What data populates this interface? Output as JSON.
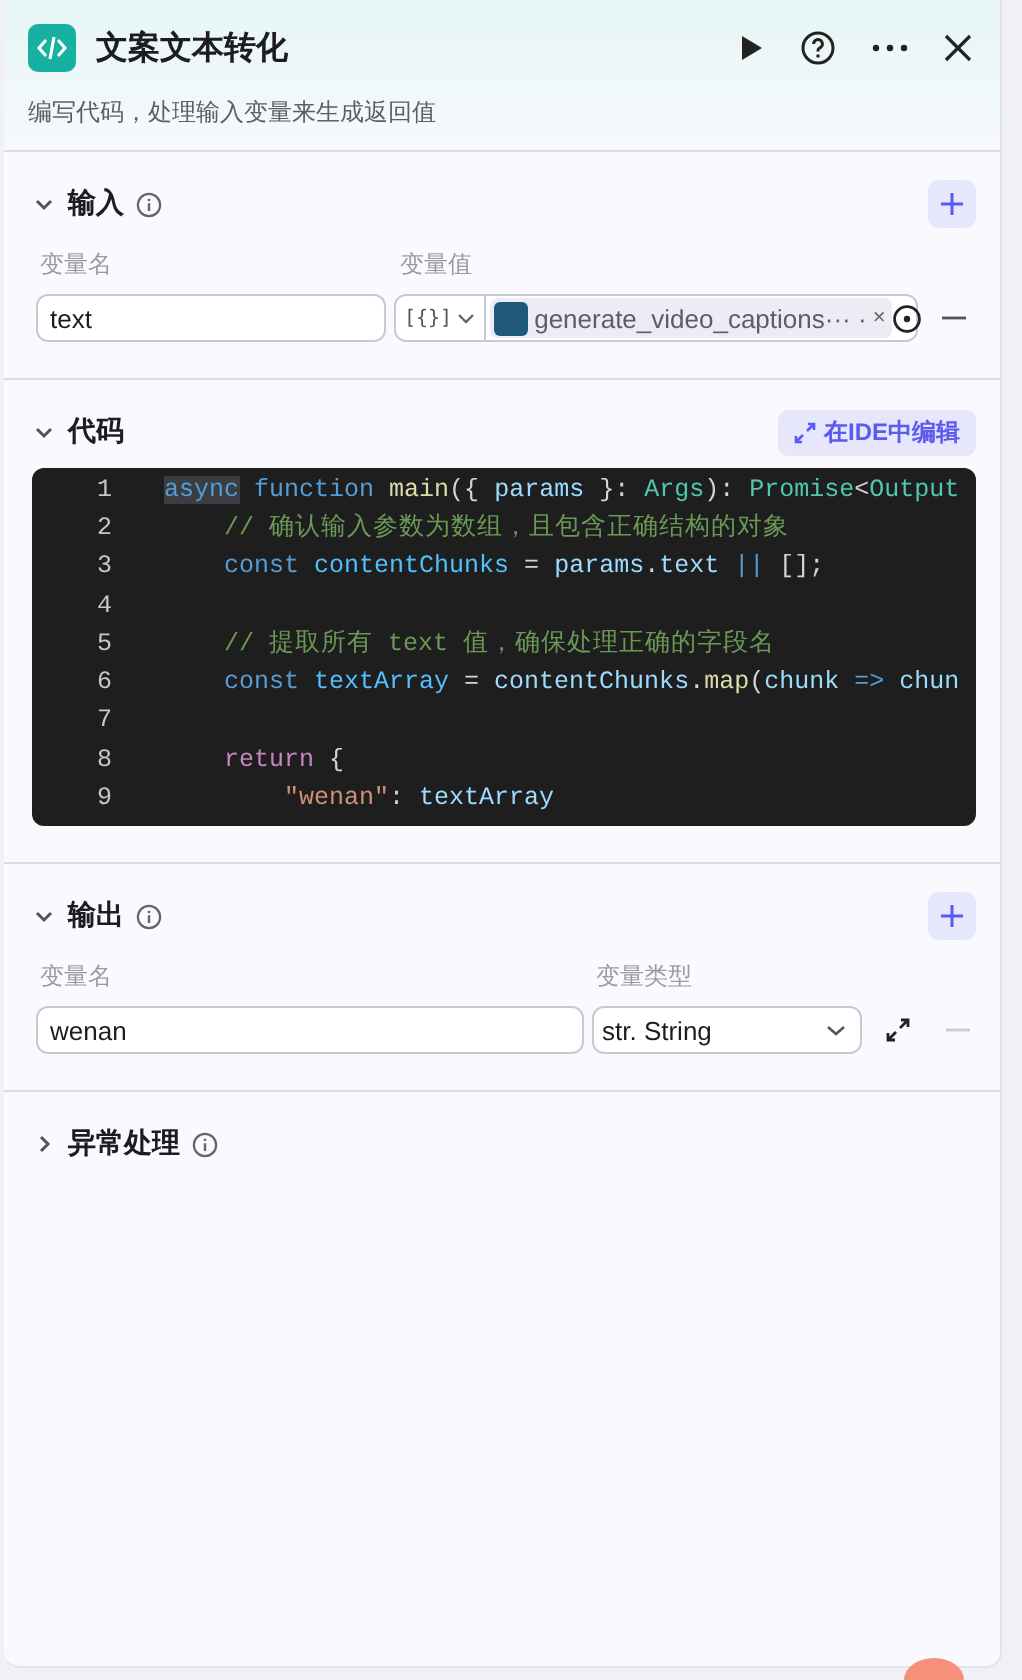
{
  "header": {
    "title": "文案文本转化",
    "description": "编写代码，处理输入变量来生成返回值"
  },
  "input": {
    "title": "输入",
    "expanded": true,
    "columns": [
      "变量名",
      "变量值"
    ],
    "rows": [
      {
        "name": "text",
        "value_type": "[{}]",
        "reference": "generate_video_captions··· ·",
        "remove": "×"
      }
    ]
  },
  "code": {
    "title": "代码",
    "edit_button": "在IDE中编辑",
    "expanded": true,
    "lines": [
      {
        "number": "1",
        "tokens": [
          {
            "kind": "keyword",
            "text": "async",
            "highlight": true
          },
          {
            "kind": "keyword",
            "text": " function"
          },
          {
            "kind": "func",
            "text": " main"
          },
          {
            "kind": "plain",
            "text": "({"
          },
          {
            "kind": "var",
            "text": " params"
          },
          {
            "kind": "plain",
            "text": " }:"
          },
          {
            "kind": "type",
            "text": " Args"
          },
          {
            "kind": "plain",
            "text": "):"
          },
          {
            "kind": "type",
            "text": " Promise"
          },
          {
            "kind": "plain",
            "text": "<"
          },
          {
            "kind": "type",
            "text": "Output"
          }
        ]
      },
      {
        "number": "2",
        "tokens": [
          {
            "kind": "comment",
            "text": "    // 确认输入参数为数组，且包含正确结构的对象"
          }
        ]
      },
      {
        "number": "3",
        "tokens": [
          {
            "kind": "keyword",
            "text": "    const"
          },
          {
            "kind": "const",
            "text": " contentChunks"
          },
          {
            "kind": "plain",
            "text": " ="
          },
          {
            "kind": "var",
            "text": " params"
          },
          {
            "kind": "plain",
            "text": "."
          },
          {
            "kind": "var",
            "text": "text"
          },
          {
            "kind": "keyword",
            "text": " ||"
          },
          {
            "kind": "plain",
            "text": " [];"
          }
        ]
      },
      {
        "number": "4"
      },
      {
        "number": "5",
        "tokens": [
          {
            "kind": "comment",
            "text": "    // 提取所有 text 值，确保处理正确的字段名"
          }
        ]
      },
      {
        "number": "6",
        "tokens": [
          {
            "kind": "keyword",
            "text": "    const"
          },
          {
            "kind": "const",
            "text": " textArray"
          },
          {
            "kind": "plain",
            "text": " ="
          },
          {
            "kind": "var",
            "text": " contentChunks"
          },
          {
            "kind": "plain",
            "text": "."
          },
          {
            "kind": "func",
            "text": "map"
          },
          {
            "kind": "plain",
            "text": "("
          },
          {
            "kind": "var",
            "text": "chunk"
          },
          {
            "kind": "keyword",
            "text": " =>"
          },
          {
            "kind": "var",
            "text": " chun"
          }
        ]
      },
      {
        "number": "7"
      },
      {
        "number": "8",
        "tokens": [
          {
            "kind": "control",
            "text": "    return"
          },
          {
            "kind": "plain",
            "text": " {"
          }
        ]
      },
      {
        "number": "9",
        "tokens": [
          {
            "kind": "string",
            "text": "        \"wenan\""
          },
          {
            "kind": "plain",
            "text": ":"
          },
          {
            "kind": "var",
            "text": " textArray"
          }
        ]
      }
    ]
  },
  "output": {
    "title": "输出",
    "expanded": true,
    "columns": [
      "变量名",
      "变量类型"
    ],
    "rows": [
      {
        "name": "wenan",
        "type": "str. String"
      }
    ]
  },
  "error_handling": {
    "title": "异常处理",
    "expanded": false
  }
}
